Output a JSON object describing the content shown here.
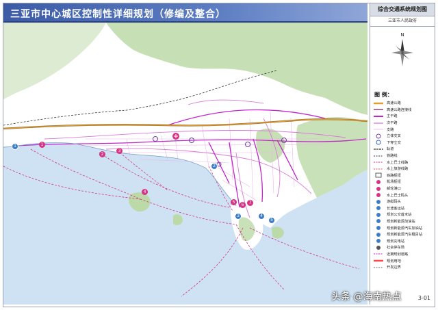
{
  "header": {
    "title": "三亚市中心城区控制性详细规划（修编及整合）"
  },
  "panel": {
    "title": "综合交通系统规划图",
    "subtitle": "三亚市人民政府",
    "legend_heading": "图 例：",
    "legend": [
      {
        "label": "高速公路",
        "color": "#e0a030",
        "kind": "double"
      },
      {
        "label": "高速公路连接线",
        "color": "#8a1e6e",
        "kind": "line"
      },
      {
        "label": "主干路",
        "color": "#c026c8",
        "kind": "thick"
      },
      {
        "label": "次干路",
        "color": "#d87ad8",
        "kind": "line"
      },
      {
        "label": "支路",
        "color": "#e9b8e9",
        "kind": "thin"
      },
      {
        "label": "立体交叉",
        "color": "#7040a0",
        "kind": "ring"
      },
      {
        "label": "下穿立交",
        "color": "#3060c0",
        "kind": "ring"
      },
      {
        "label": "轨道",
        "color": "#555555",
        "kind": "rail"
      },
      {
        "label": "铁路线",
        "color": "#333333",
        "kind": "dash"
      },
      {
        "label": "水上巴士线路",
        "color": "#d63384",
        "kind": "dash"
      },
      {
        "label": "水上旅游线路",
        "color": "#e05060",
        "kind": "dash"
      },
      {
        "label": "铁路枢纽",
        "color": "#ffffff",
        "kind": "box"
      },
      {
        "label": "机场枢纽",
        "color": "#d63384",
        "kind": "dot"
      },
      {
        "label": "邮轮港口",
        "color": "#d63384",
        "kind": "dot"
      },
      {
        "label": "水上巴士码头",
        "color": "#d63384",
        "kind": "dot"
      },
      {
        "label": "游艇码头",
        "color": "#3d7cc9",
        "kind": "dot"
      },
      {
        "label": "长途客运站",
        "color": "#3d7cc9",
        "kind": "dot"
      },
      {
        "label": "规划公交首末站",
        "color": "#3d7cc9",
        "kind": "dot"
      },
      {
        "label": "规划新能源加油站",
        "color": "#3d7cc9",
        "kind": "dot"
      },
      {
        "label": "规划新能源汽车加油站",
        "color": "#3d7cc9",
        "kind": "dot"
      },
      {
        "label": "规划新能源汽车租赁站",
        "color": "#3d7cc9",
        "kind": "dot"
      },
      {
        "label": "规划充电站",
        "color": "#3d7cc9",
        "kind": "dot"
      },
      {
        "label": "社会停车场",
        "color": "#555555",
        "kind": "dot"
      },
      {
        "label": "近期规划道路",
        "color": "#c026c8",
        "kind": "dash"
      },
      {
        "label": "规划用地",
        "color": "#ff4444",
        "kind": "double"
      },
      {
        "label": "开发边界",
        "color": "#666666",
        "kind": "dash"
      }
    ]
  },
  "footer": {
    "page": "3-01",
    "watermark": "头条 @海南热点"
  }
}
